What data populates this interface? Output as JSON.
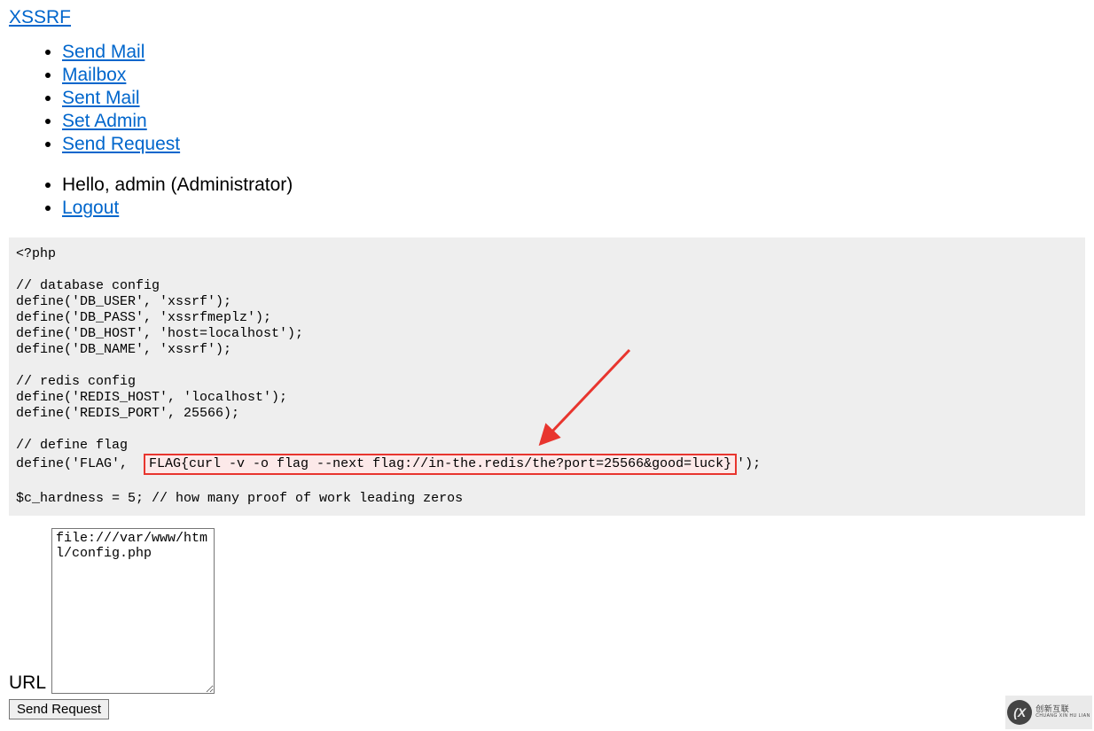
{
  "brand": "XSSRF",
  "nav": {
    "items": [
      {
        "label": "Send Mail"
      },
      {
        "label": "Mailbox"
      },
      {
        "label": "Sent Mail"
      },
      {
        "label": "Set Admin"
      },
      {
        "label": "Send Request"
      }
    ],
    "greeting": "Hello, admin (Administrator)",
    "logout": "Logout"
  },
  "code": {
    "line01": "<?php",
    "line02": "",
    "line03": "// database config",
    "line04": "define('DB_USER', 'xssrf');",
    "line05": "define('DB_PASS', 'xssrfmeplz');",
    "line06": "define('DB_HOST', 'host=localhost');",
    "line07": "define('DB_NAME', 'xssrf');",
    "line08": "",
    "line09": "// redis config",
    "line10": "define('REDIS_HOST', 'localhost');",
    "line11": "define('REDIS_PORT', 25566);",
    "line12": "",
    "line13": "// define flag",
    "line14_prefix": "define('FLAG',  ",
    "line14_flag": "FLAG{curl -v -o flag --next flag://in-the.redis/the?port=25566&good=luck}",
    "line14_suffix": "');",
    "line15": "",
    "line16": "$c_hardness = 5; // how many proof of work leading zeros"
  },
  "form": {
    "url_label": "URL",
    "url_value": "file:///var/www/html/config.php",
    "submit_label": "Send Request"
  },
  "watermark": {
    "logo": "(X",
    "text1": "创新互联",
    "text2": "CHUANG XIN HU LIAN"
  }
}
